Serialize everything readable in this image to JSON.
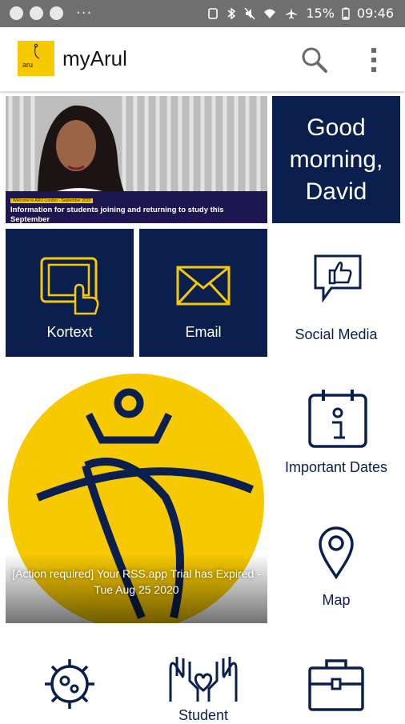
{
  "status_bar": {
    "battery": "15%",
    "time": "09:46",
    "more": "···"
  },
  "app_bar": {
    "logo_text": "aru",
    "title": "myArul"
  },
  "news": {
    "caption_small": "Welcome to ARU London - September 2020",
    "caption": "Information for students joining and returning to study this September"
  },
  "greeting": {
    "line1": "Good",
    "line2": "morning,",
    "line3": "David"
  },
  "tiles": {
    "kortext": "Kortext",
    "email": "Email",
    "social_media": "Social Media",
    "important_dates": "Important Dates",
    "map": "Map",
    "student": "Student"
  },
  "rss": {
    "message": "[Action required] Your RSS.app Trial has Expired - Tue Aug 25 2020"
  },
  "colors": {
    "navy": "#0a1f4e",
    "yellow": "#f7c900",
    "status_bar": "#6f6f6f"
  },
  "icons": [
    "tablet-touch-icon",
    "envelope-icon",
    "thumbs-up-chat-icon",
    "calendar-info-icon",
    "map-pin-icon",
    "virus-icon",
    "hands-heart-icon",
    "briefcase-icon"
  ]
}
